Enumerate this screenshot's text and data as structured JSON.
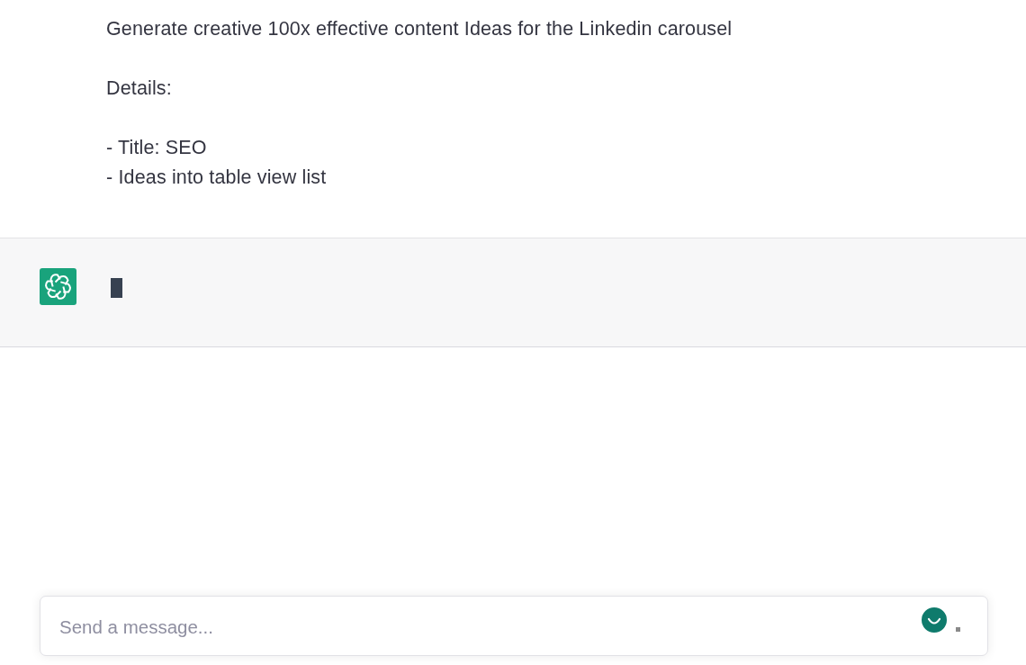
{
  "user_message": {
    "paragraphs": [
      {
        "lines": [
          "Generate creative 100x effective content Ideas for the Linkedin carousel"
        ]
      },
      {
        "lines": [
          "Details:"
        ]
      },
      {
        "lines": [
          "- Title: SEO",
          "- Ideas into table view list"
        ]
      }
    ]
  },
  "assistant_message": {
    "streaming": true
  },
  "composer": {
    "placeholder": "Send a message..."
  }
}
